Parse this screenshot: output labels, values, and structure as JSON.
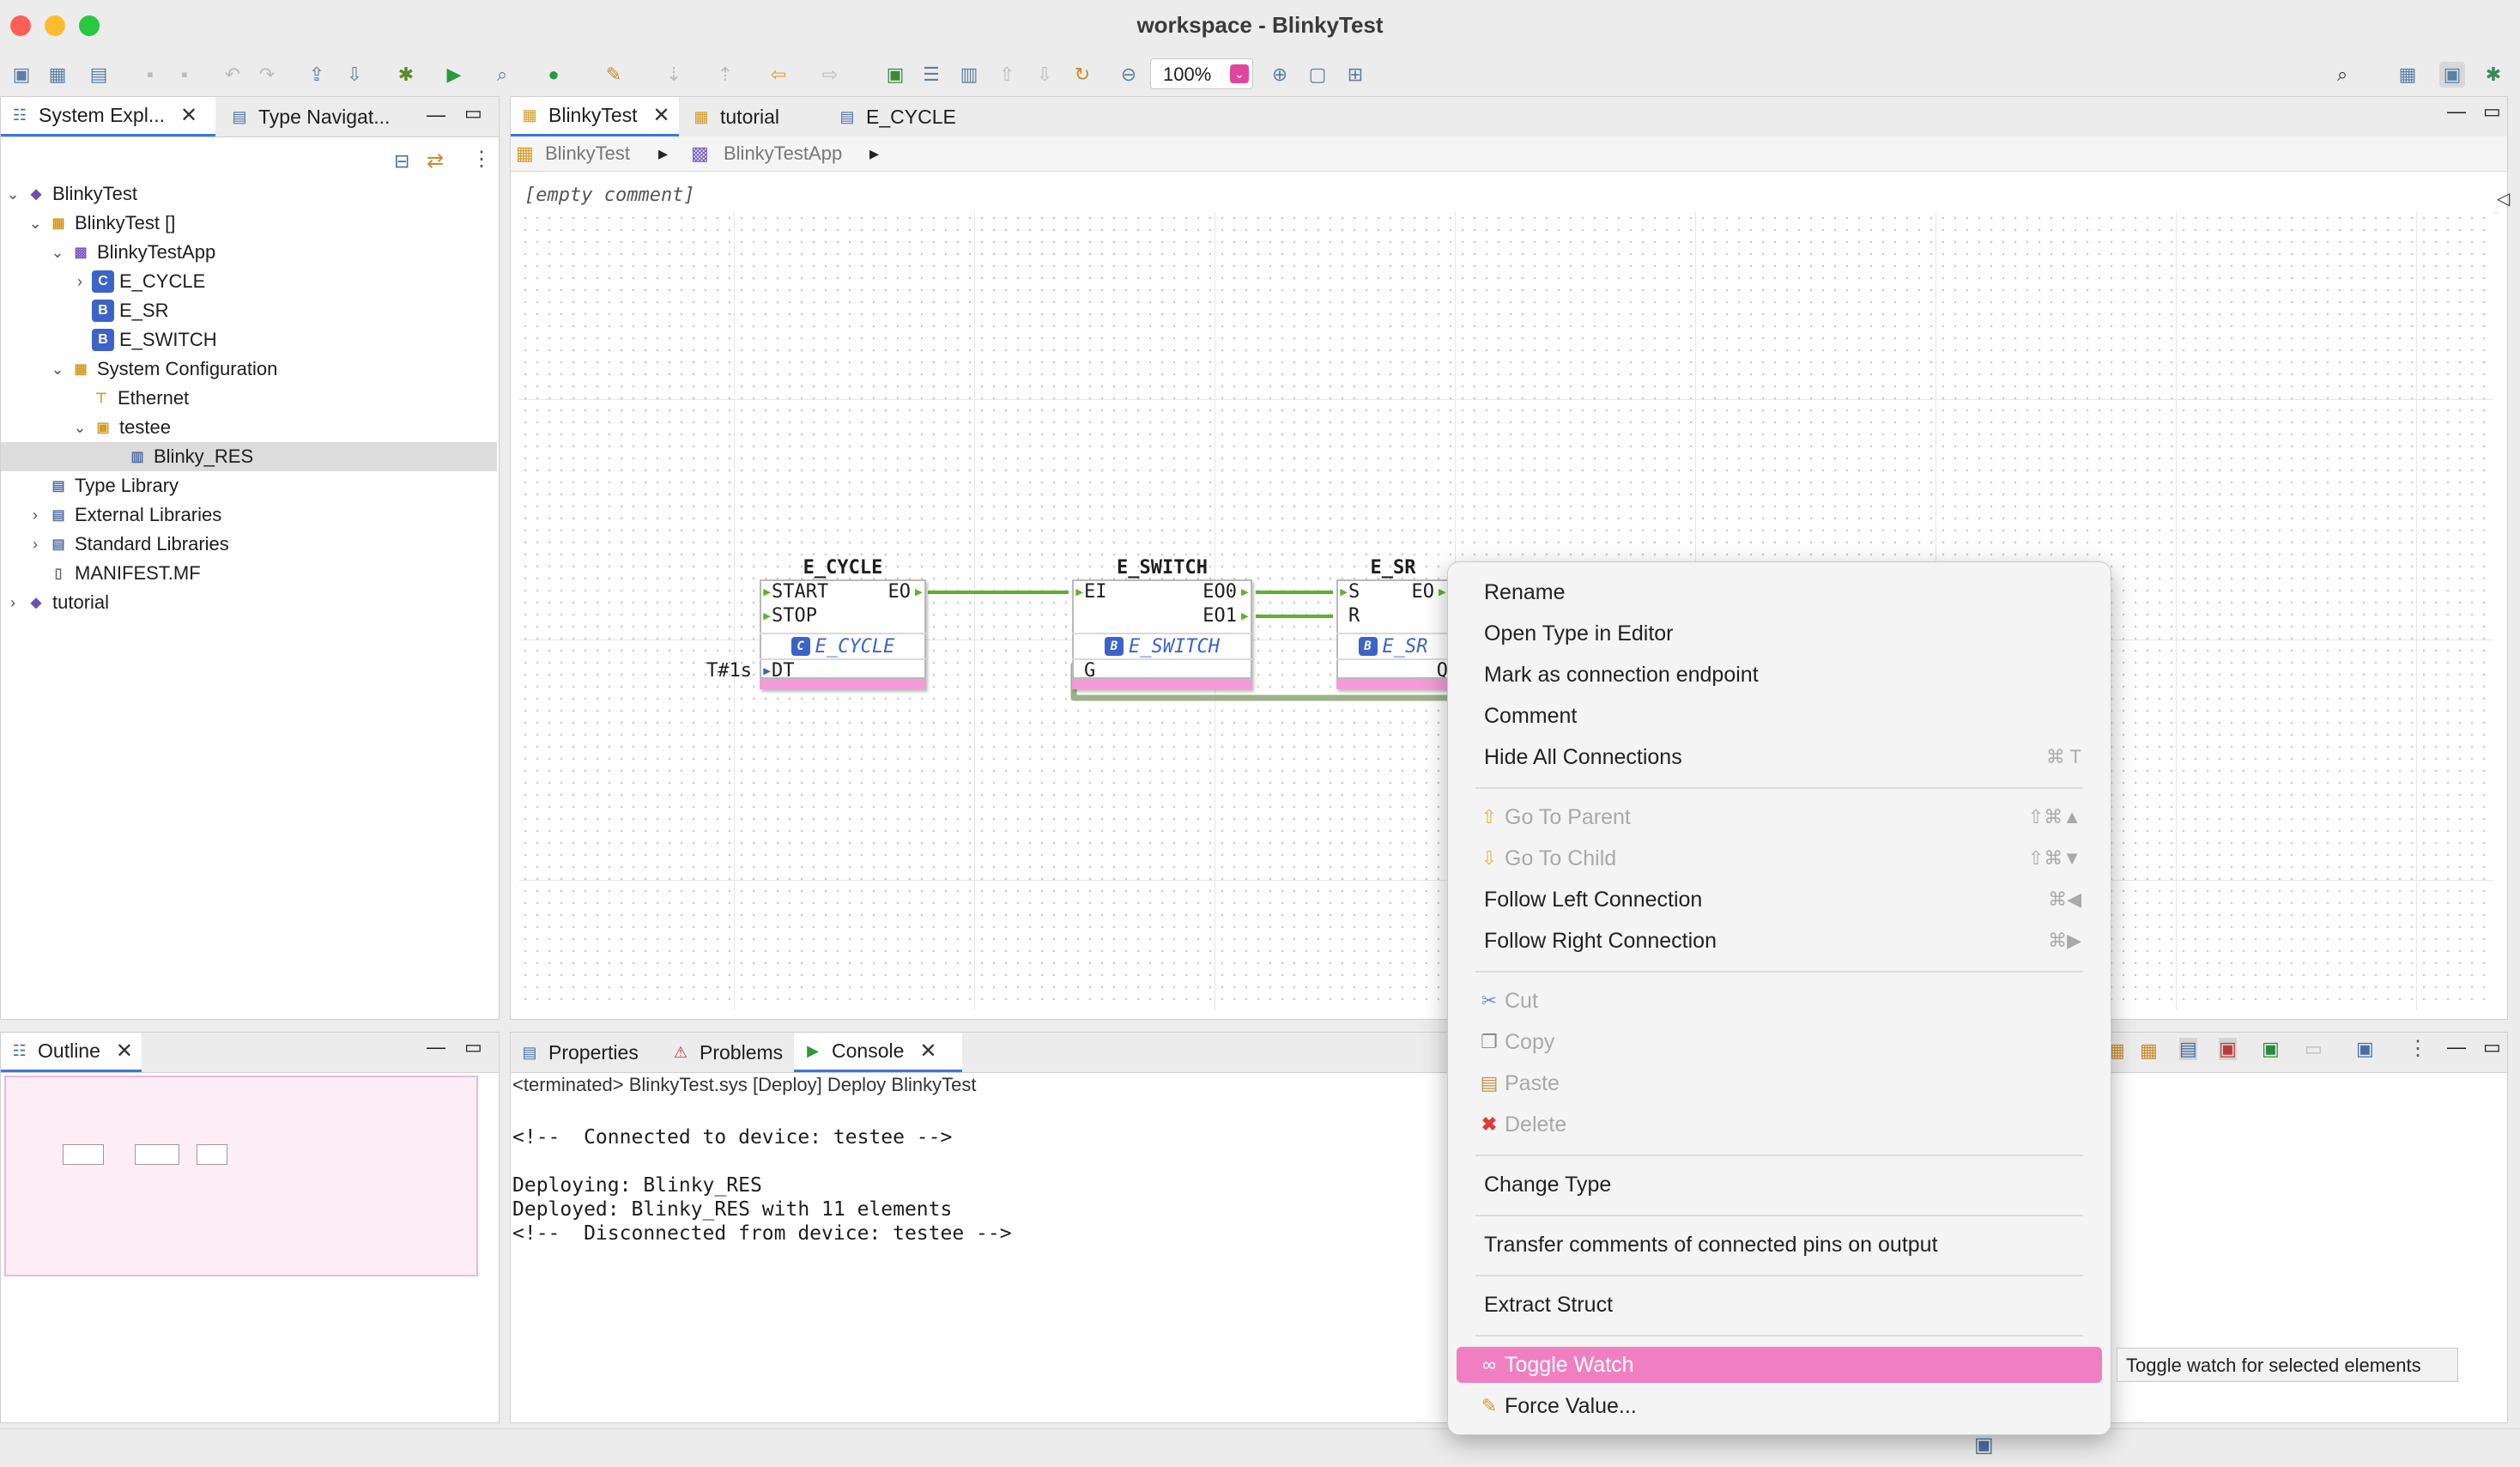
{
  "window": {
    "title": "workspace - BlinkyTest"
  },
  "toolbar": {
    "zoom": "100%"
  },
  "left_panel": {
    "tabs": [
      {
        "label": "System Expl..."
      },
      {
        "label": "Type Navigat..."
      }
    ],
    "tree": [
      {
        "label": "BlinkyTest"
      },
      {
        "label": "BlinkyTest []"
      },
      {
        "label": "BlinkyTestApp"
      },
      {
        "label": "E_CYCLE"
      },
      {
        "label": "E_SR"
      },
      {
        "label": "E_SWITCH"
      },
      {
        "label": "System Configuration"
      },
      {
        "label": "Ethernet"
      },
      {
        "label": "testee"
      },
      {
        "label": "Blinky_RES"
      },
      {
        "label": "Type Library"
      },
      {
        "label": "External Libraries"
      },
      {
        "label": "Standard Libraries"
      },
      {
        "label": "MANIFEST.MF"
      },
      {
        "label": "tutorial"
      }
    ]
  },
  "editor": {
    "tabs": [
      {
        "label": "BlinkyTest"
      },
      {
        "label": "tutorial"
      },
      {
        "label": "E_CYCLE"
      }
    ],
    "breadcrumb": [
      "BlinkyTest",
      "BlinkyTestApp"
    ],
    "comment": "[empty comment]",
    "blocks": {
      "cycle": {
        "name": "E_CYCLE",
        "type": "E_CYCLE",
        "in1": "START",
        "in2": "STOP",
        "out1": "EO",
        "data_in": "DT",
        "param": "T#1s"
      },
      "switch": {
        "name": "E_SWITCH",
        "type": "E_SWITCH",
        "in1": "EI",
        "out1": "EO0",
        "out2": "EO1",
        "data_in": "G"
      },
      "sr": {
        "name": "E_SR",
        "type": "E_SR",
        "in1": "S",
        "in2": "R",
        "out1": "EO",
        "data_out": "Q"
      }
    }
  },
  "outline": {
    "tab": "Outline"
  },
  "bottom_panel": {
    "tabs": [
      {
        "label": "Properties"
      },
      {
        "label": "Problems"
      },
      {
        "label": "Console"
      }
    ],
    "status": "<terminated> BlinkyTest.sys [Deploy] Deploy BlinkyTest",
    "lines": [
      "<!--  Connected to device: testee -->",
      "",
      "Deploying: Blinky_RES",
      "Deployed: Blinky_RES with 11 elements",
      "<!--  Disconnected from device: testee -->"
    ]
  },
  "context_menu": {
    "items": {
      "rename": {
        "label": "Rename"
      },
      "open_type": {
        "label": "Open Type in Editor"
      },
      "mark_endpoint": {
        "label": "Mark as connection endpoint"
      },
      "comment": {
        "label": "Comment"
      },
      "hide_all": {
        "label": "Hide All Connections",
        "shortcut": "⌘ T"
      },
      "go_parent": {
        "label": "Go To Parent",
        "shortcut": "⇧⌘▲"
      },
      "go_child": {
        "label": "Go To Child",
        "shortcut": "⇧⌘▼"
      },
      "follow_left": {
        "label": "Follow Left Connection",
        "shortcut": "⌘◀"
      },
      "follow_right": {
        "label": "Follow Right Connection",
        "shortcut": "⌘▶"
      },
      "cut": {
        "label": "Cut"
      },
      "copy": {
        "label": "Copy"
      },
      "paste": {
        "label": "Paste"
      },
      "delete": {
        "label": "Delete"
      },
      "change_type": {
        "label": "Change Type"
      },
      "transfer_comments": {
        "label": "Transfer comments of connected pins on output"
      },
      "extract_struct": {
        "label": "Extract Struct"
      },
      "toggle_watch": {
        "label": "Toggle Watch"
      },
      "force_value": {
        "label": "Force Value..."
      }
    },
    "tooltip": "Toggle watch for selected elements"
  },
  "colors": {
    "accent": "#f07fc1",
    "connection": "#5fb02c",
    "block_bottom": "#f29bd6"
  }
}
